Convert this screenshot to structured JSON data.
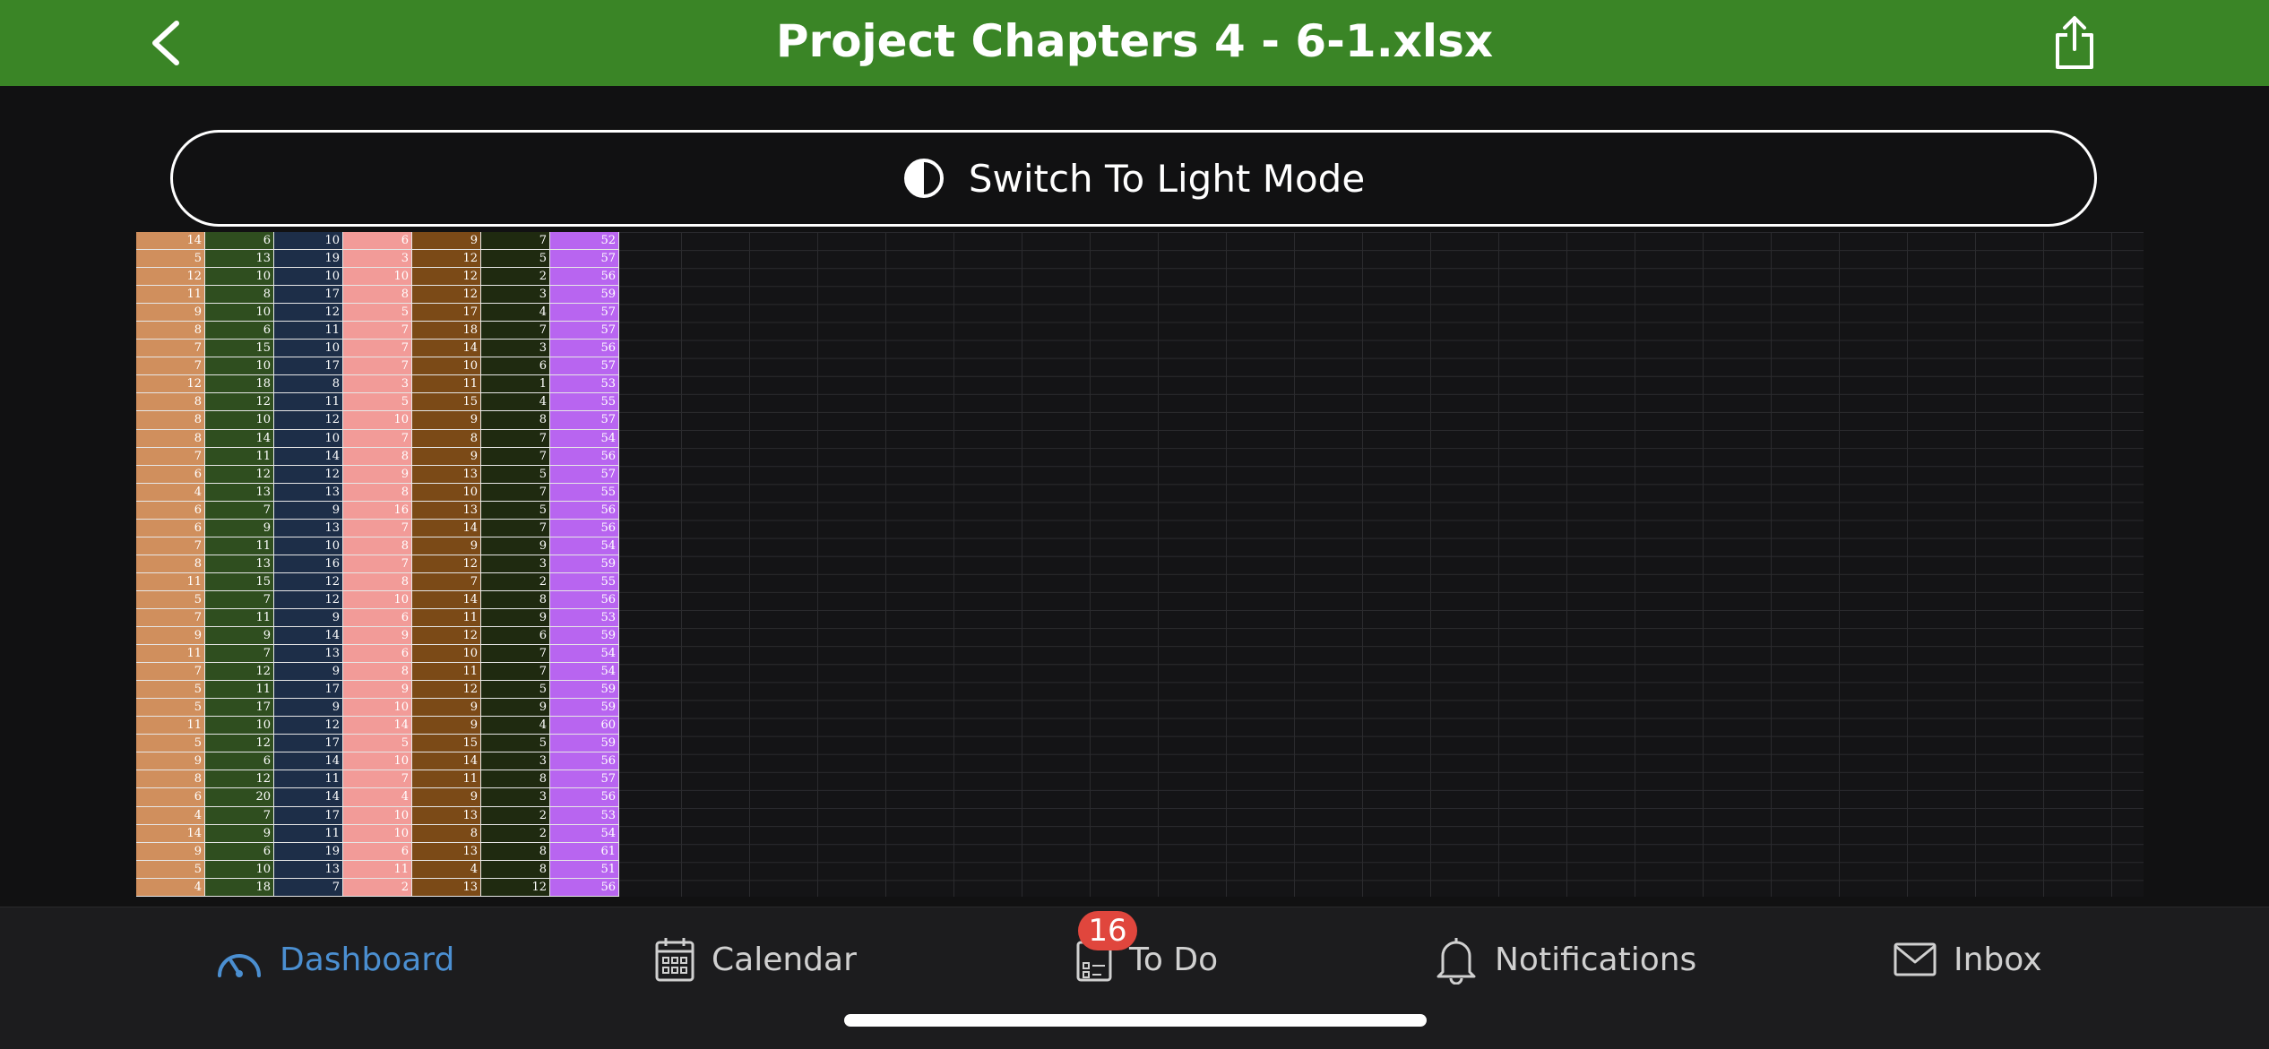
{
  "header": {
    "title": "Project Chapters 4 - 6-1.xlsx",
    "back_icon": "chevron-left-icon",
    "share_icon": "share-icon"
  },
  "mode_button": {
    "label": "Switch To Light Mode",
    "icon": "contrast-icon"
  },
  "sheet": {
    "column_colors": [
      "#d08f5d",
      "#2f4e1f",
      "#1d2e48",
      "#f29b98",
      "#7b4a17",
      "#1f2a10",
      "#b865f0"
    ],
    "rows": [
      [
        14,
        6,
        10,
        6,
        9,
        7,
        52
      ],
      [
        5,
        13,
        19,
        3,
        12,
        5,
        57
      ],
      [
        12,
        10,
        10,
        10,
        12,
        2,
        56
      ],
      [
        11,
        8,
        17,
        8,
        12,
        3,
        59
      ],
      [
        9,
        10,
        12,
        5,
        17,
        4,
        57
      ],
      [
        8,
        6,
        11,
        7,
        18,
        7,
        57
      ],
      [
        7,
        15,
        10,
        7,
        14,
        3,
        56
      ],
      [
        7,
        10,
        17,
        7,
        10,
        6,
        57
      ],
      [
        12,
        18,
        8,
        3,
        11,
        1,
        53
      ],
      [
        8,
        12,
        11,
        5,
        15,
        4,
        55
      ],
      [
        8,
        10,
        12,
        10,
        9,
        8,
        57
      ],
      [
        8,
        14,
        10,
        7,
        8,
        7,
        54
      ],
      [
        7,
        11,
        14,
        8,
        9,
        7,
        56
      ],
      [
        6,
        12,
        12,
        9,
        13,
        5,
        57
      ],
      [
        4,
        13,
        13,
        8,
        10,
        7,
        55
      ],
      [
        6,
        7,
        9,
        16,
        13,
        5,
        56
      ],
      [
        6,
        9,
        13,
        7,
        14,
        7,
        56
      ],
      [
        7,
        11,
        10,
        8,
        9,
        9,
        54
      ],
      [
        8,
        13,
        16,
        7,
        12,
        3,
        59
      ],
      [
        11,
        15,
        12,
        8,
        7,
        2,
        55
      ],
      [
        5,
        7,
        12,
        10,
        14,
        8,
        56
      ],
      [
        7,
        11,
        9,
        6,
        11,
        9,
        53
      ],
      [
        9,
        9,
        14,
        9,
        12,
        6,
        59
      ],
      [
        11,
        7,
        13,
        6,
        10,
        7,
        54
      ],
      [
        7,
        12,
        9,
        8,
        11,
        7,
        54
      ],
      [
        5,
        11,
        17,
        9,
        12,
        5,
        59
      ],
      [
        5,
        17,
        9,
        10,
        9,
        9,
        59
      ],
      [
        11,
        10,
        12,
        14,
        9,
        4,
        60
      ],
      [
        5,
        12,
        17,
        5,
        15,
        5,
        59
      ],
      [
        9,
        6,
        14,
        10,
        14,
        3,
        56
      ],
      [
        8,
        12,
        11,
        7,
        11,
        8,
        57
      ],
      [
        6,
        20,
        14,
        4,
        9,
        3,
        56
      ],
      [
        4,
        7,
        17,
        10,
        13,
        2,
        53
      ],
      [
        14,
        9,
        11,
        10,
        8,
        2,
        54
      ],
      [
        9,
        6,
        19,
        6,
        13,
        8,
        61
      ],
      [
        5,
        10,
        13,
        11,
        4,
        8,
        51
      ],
      [
        4,
        18,
        7,
        2,
        13,
        12,
        56
      ]
    ]
  },
  "tabbar": {
    "tabs": [
      {
        "label": "Dashboard",
        "icon": "speedometer-icon",
        "active": true
      },
      {
        "label": "Calendar",
        "icon": "calendar-icon",
        "active": false
      },
      {
        "label": "To Do",
        "icon": "todo-icon",
        "active": false,
        "badge": "16"
      },
      {
        "label": "Notifications",
        "icon": "bell-icon",
        "active": false
      },
      {
        "label": "Inbox",
        "icon": "envelope-icon",
        "active": false
      }
    ],
    "active_color": "#4b8fd1"
  }
}
